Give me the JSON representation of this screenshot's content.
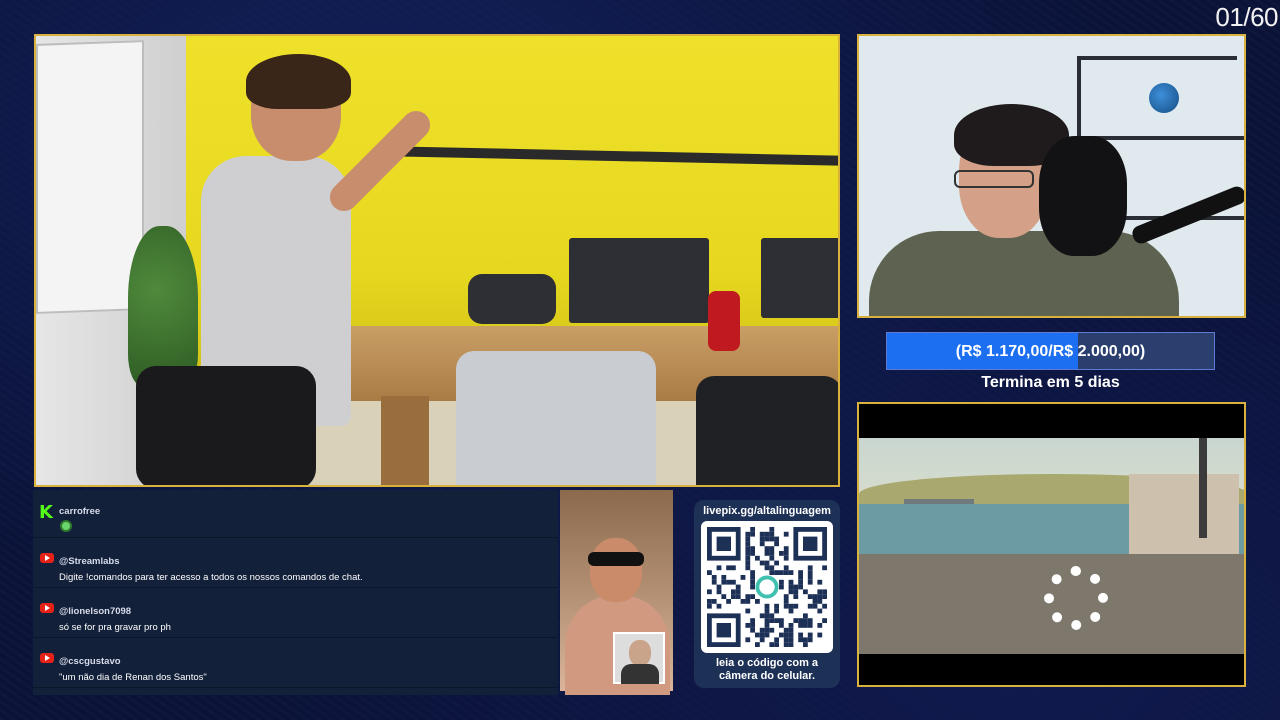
{
  "overlay": {
    "counter": "01/60"
  },
  "goal": {
    "label": "(R$ 1.170,00/R$ 2.000,00)",
    "progress": 0.585,
    "subtitle": "Termina em 5 dias",
    "fill_color": "#1b6ff0"
  },
  "chat": {
    "messages": [
      {
        "platform": "kick",
        "icon": "kick-logo-icon",
        "user": "carrofree",
        "text": "",
        "emote": "green-emote-icon"
      },
      {
        "platform": "youtube",
        "icon": "youtube-icon",
        "user": "@Streamlabs",
        "text": "Digite !comandos para ter acesso a todos os nossos comandos de chat."
      },
      {
        "platform": "youtube",
        "icon": "youtube-icon",
        "user": "@lionelson7098",
        "text": "só se for pra gravar pro ph"
      },
      {
        "platform": "youtube",
        "icon": "youtube-icon",
        "user": "@cscgustavo",
        "text": "\"um não dia de Renan dos Santos\""
      }
    ]
  },
  "qr": {
    "url": "livepix.gg/altalinguagem",
    "caption_line1": "leia o código com a",
    "caption_line2": "câmera do celular."
  },
  "colors": {
    "panel_border": "#d8b23c",
    "background": "#0a1238",
    "youtube": "#e62117",
    "kick": "#53fc18"
  }
}
